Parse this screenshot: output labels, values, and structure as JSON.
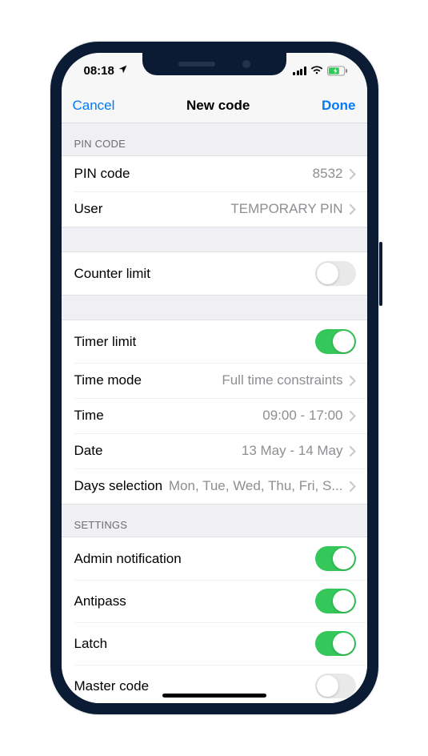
{
  "status": {
    "time": "08:18"
  },
  "nav": {
    "cancel": "Cancel",
    "title": "New code",
    "done": "Done"
  },
  "pin_section": {
    "header": "PIN CODE",
    "pin_label": "PIN code",
    "pin_value": "8532",
    "user_label": "User",
    "user_value": "TEMPORARY PIN"
  },
  "counter": {
    "label": "Counter limit",
    "on": false
  },
  "timer": {
    "limit_label": "Timer limit",
    "limit_on": true,
    "mode_label": "Time mode",
    "mode_value": "Full time constraints",
    "time_label": "Time",
    "time_value": "09:00 - 17:00",
    "date_label": "Date",
    "date_value": "13 May - 14 May",
    "days_label": "Days selection",
    "days_value": "Mon, Tue, Wed, Thu, Fri, S..."
  },
  "settings": {
    "header": "SETTINGS",
    "admin_label": "Admin notification",
    "admin_on": true,
    "antipass_label": "Antipass",
    "antipass_on": true,
    "latch_label": "Latch",
    "latch_on": true,
    "master_label": "Master code",
    "master_on": false
  }
}
